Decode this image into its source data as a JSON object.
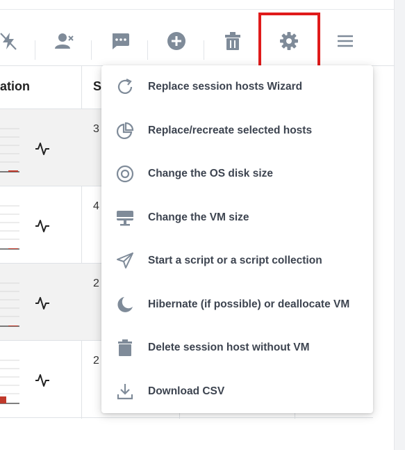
{
  "toolbar": {
    "buttons": [
      {
        "name": "bolt-off-icon"
      },
      {
        "name": "user-remove-icon"
      },
      {
        "name": "message-icon"
      },
      {
        "name": "add-circle-icon"
      },
      {
        "name": "trash-icon"
      },
      {
        "name": "gear-icon"
      },
      {
        "name": "menu-icon"
      }
    ],
    "highlight_color": "#e01b1b"
  },
  "table": {
    "headers": [
      "ation",
      "S"
    ],
    "rows": [
      {
        "sessions": "3"
      },
      {
        "sessions": "4"
      },
      {
        "sessions": "2"
      },
      {
        "sessions": "2"
      }
    ]
  },
  "menu": {
    "items": [
      {
        "label": "Replace session hosts Wizard",
        "icon": "refresh-icon"
      },
      {
        "label": "Replace/recreate selected hosts",
        "icon": "pie-chart-icon"
      },
      {
        "label": "Change the OS disk size",
        "icon": "disk-icon"
      },
      {
        "label": "Change the VM size",
        "icon": "monitor-icon"
      },
      {
        "label": "Start a script or a script collection",
        "icon": "send-icon"
      },
      {
        "label": "Hibernate (if possible) or deallocate VM",
        "icon": "moon-icon"
      },
      {
        "label": "Delete session host without VM",
        "icon": "trash-icon"
      },
      {
        "label": "Download CSV",
        "icon": "download-icon"
      }
    ]
  },
  "colors": {
    "icon": "#7f8b99",
    "accent_bar": "#c0392b"
  }
}
